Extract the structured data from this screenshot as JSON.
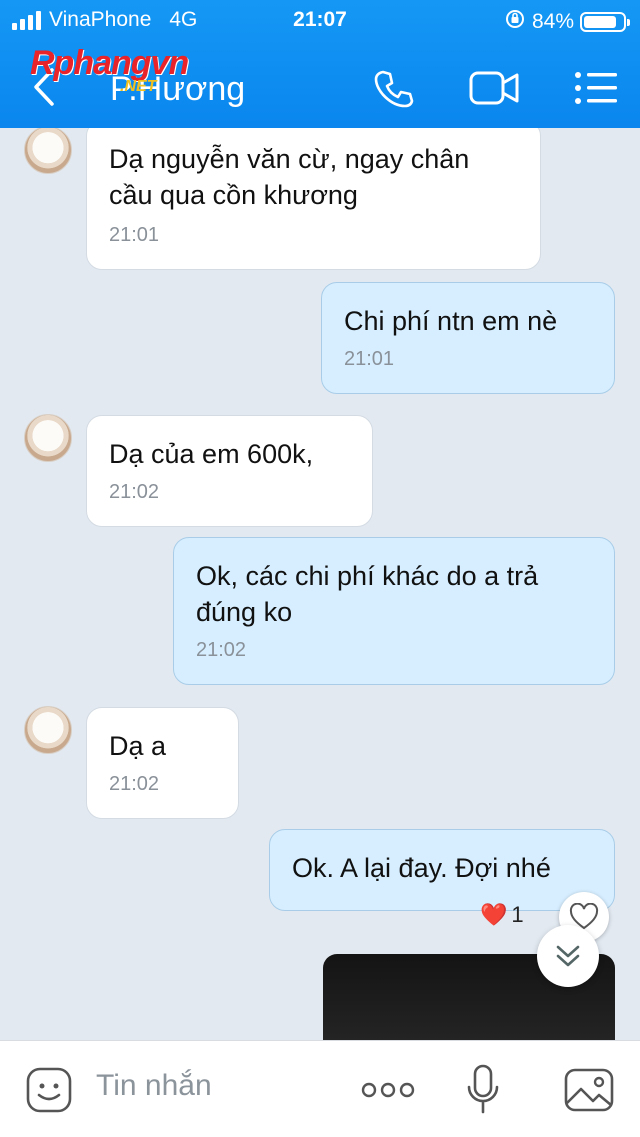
{
  "status_bar": {
    "carrier": "VinaPhone",
    "network": "4G",
    "time": "21:07",
    "battery": "84%",
    "battery_level": 0.84
  },
  "header": {
    "contact_name": "P.Hương",
    "watermark": "Rphangvn",
    "watermark_sub": ".NET"
  },
  "messages": [
    {
      "dir": "in",
      "text": "Dạ nguyễn văn cừ, ngay chân cầu qua cồn khương",
      "time": "21:01"
    },
    {
      "dir": "out",
      "text": "Chi phí ntn em nè",
      "time": "21:01"
    },
    {
      "dir": "in",
      "text": "Dạ của em 600k,",
      "time": "21:02"
    },
    {
      "dir": "out",
      "text": "Ok, các chi phí khác do a trả đúng ko",
      "time": "21:02"
    },
    {
      "dir": "in",
      "text": "Dạ a",
      "time": "21:02"
    },
    {
      "dir": "out",
      "text": "Ok. A lại đay. Đợi nhé",
      "time": ""
    }
  ],
  "reaction": {
    "emoji": "❤️",
    "count": "1"
  },
  "composer": {
    "placeholder": "Tin nhắn"
  },
  "colors": {
    "header": "#0a86ee",
    "incoming": "#ffffff",
    "outgoing": "#d6eeff",
    "background": "#e2e9f1"
  }
}
